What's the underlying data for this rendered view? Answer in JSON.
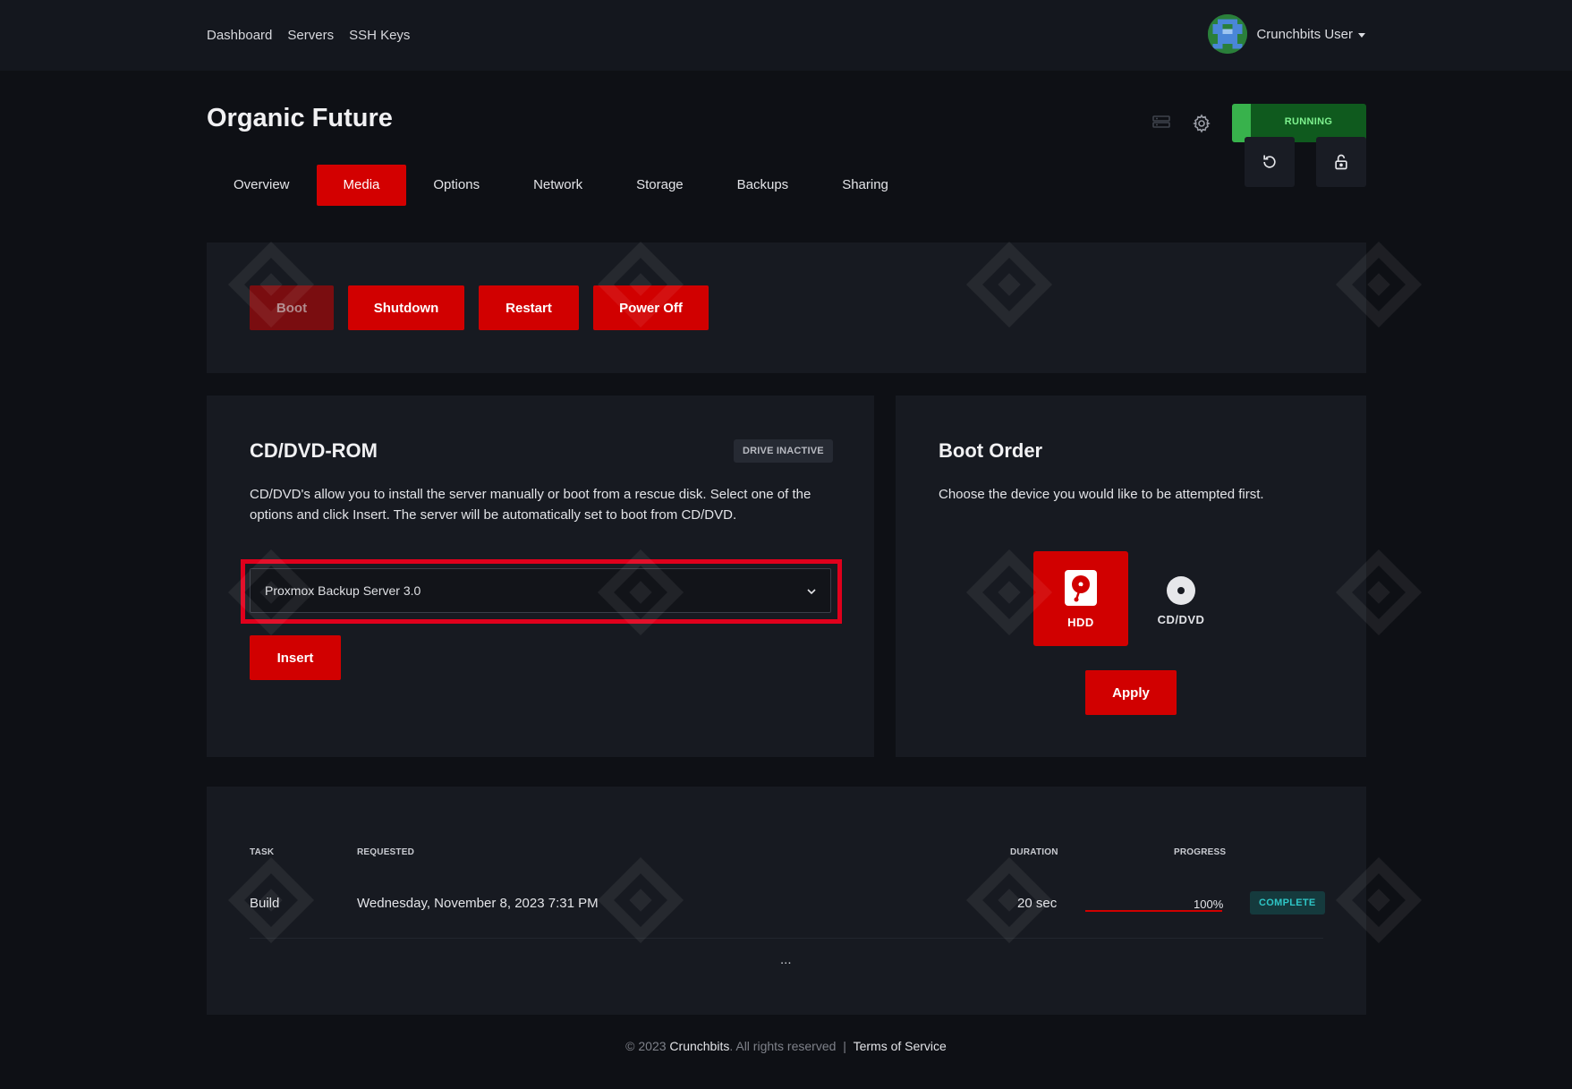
{
  "nav": {
    "links": [
      "Dashboard",
      "Servers",
      "SSH Keys"
    ],
    "user_name": "Crunchbits User"
  },
  "server": {
    "name": "Organic Future",
    "status": "RUNNING"
  },
  "tabs": [
    "Overview",
    "Media",
    "Options",
    "Network",
    "Storage",
    "Backups",
    "Sharing"
  ],
  "active_tab": "Media",
  "power": {
    "boot": "Boot",
    "shutdown": "Shutdown",
    "restart": "Restart",
    "power_off": "Power Off"
  },
  "cdrom": {
    "title": "CD/DVD-ROM",
    "badge": "DRIVE INACTIVE",
    "description": "CD/DVD's allow you to install the server manually or boot from a rescue disk. Select one of the options and click Insert. The server will be automatically set to boot from CD/DVD.",
    "selected_iso": "Proxmox Backup Server 3.0",
    "insert_label": "Insert"
  },
  "boot_order": {
    "title": "Boot Order",
    "description": "Choose the device you would like to be attempted first.",
    "options": [
      "HDD",
      "CD/DVD"
    ],
    "apply_label": "Apply"
  },
  "tasks": {
    "headers": {
      "task": "TASK",
      "requested": "REQUESTED",
      "duration": "DURATION",
      "progress": "PROGRESS"
    },
    "rows": [
      {
        "task": "Build",
        "requested": "Wednesday, November 8, 2023 7:31 PM",
        "duration": "20 sec",
        "progress": "100%",
        "status": "COMPLETE"
      }
    ],
    "more": "..."
  },
  "footer": {
    "copyright": "© 2023",
    "brand": "Crunchbits",
    "rights": ". All rights reserved",
    "sep": "|",
    "terms": "Terms of Service"
  },
  "colors": {
    "background": "#0e1015",
    "panel": "#171a21",
    "accent_red": "#d10000",
    "running_green": "#0f5a1e",
    "complete_teal": "#2ec6c6"
  }
}
